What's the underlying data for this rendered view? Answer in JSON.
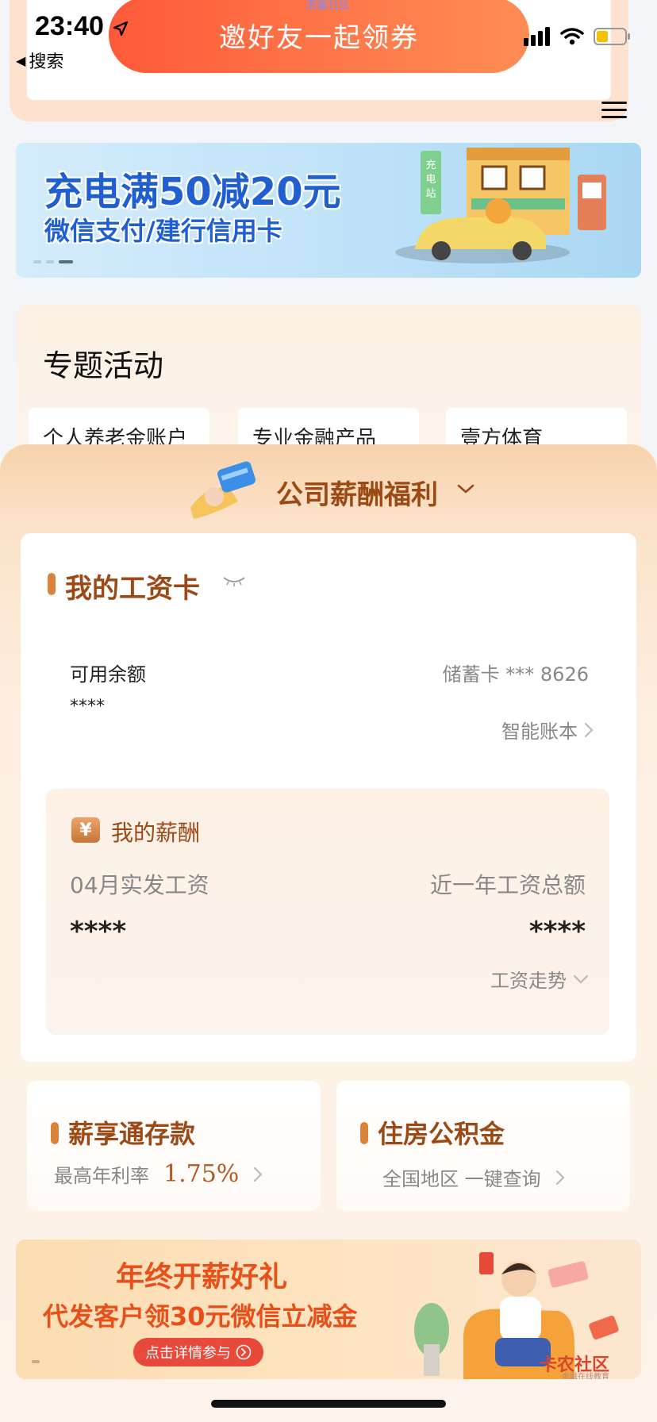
{
  "status_bar": {
    "time": "23:40",
    "back_label": "搜索"
  },
  "top": {
    "invite_tag": "流量社区",
    "invite_button": "邀好友一起领券"
  },
  "banner": {
    "title": "充电满50减20元",
    "subtitle": "微信支付/建行信用卡",
    "sign_text": "充电站"
  },
  "topics": {
    "title": "专题活动",
    "items": [
      "个人养老金账户",
      "专业金融产品",
      "壹方体育"
    ]
  },
  "salary": {
    "header": "公司薪酬福利",
    "card": {
      "title": "我的工资卡",
      "balance_label": "可用余额",
      "balance_value": "****",
      "card_info": "储蓄卡 *** 8626",
      "smart_book": "智能账本"
    },
    "pay": {
      "title": "我的薪酬",
      "yen": "¥",
      "month_label": "04月实发工资",
      "year_label": "近一年工资总额",
      "month_value": "****",
      "year_value": "****",
      "trend": "工资走势"
    },
    "deposit": {
      "title": "薪享通存款",
      "sub": "最高年利率",
      "rate": "1.75%"
    },
    "fund": {
      "title": "住房公积金",
      "sub": "全国地区 一键查询"
    },
    "promo": {
      "title": "年终开薪好礼",
      "subtitle": "代发客户领30元微信立减金",
      "button": "点击详情参与",
      "watermark": "卡农社区",
      "watermark_sub": "金融在线教育"
    }
  },
  "colors": {
    "accent": "#9b4a16",
    "invite": "#fe5a3a",
    "banner_text": "#1f5fcf",
    "promo": "#e8501a"
  }
}
